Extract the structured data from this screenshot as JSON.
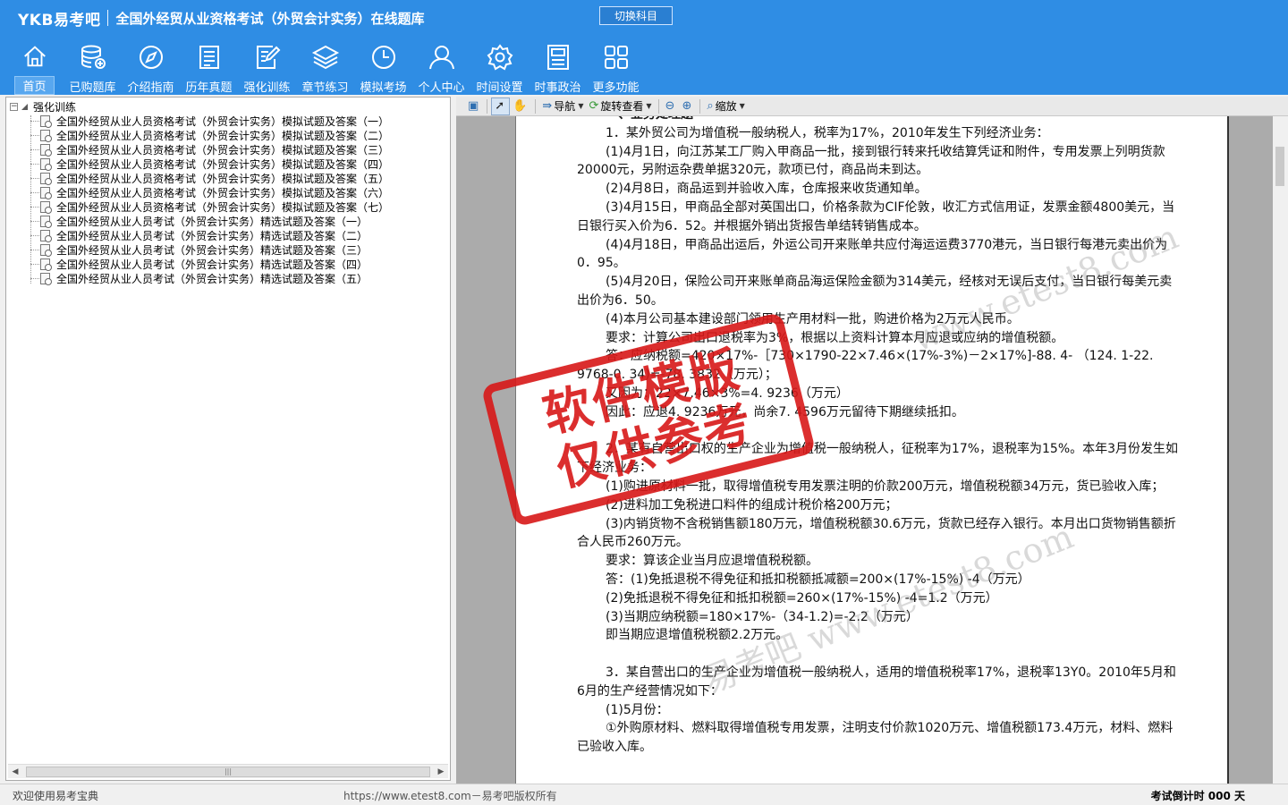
{
  "header": {
    "logo": "YKB易考吧",
    "title": "全国外经贸从业资格考试（外贸会计实务）在线题库",
    "switch_label": "切换科目"
  },
  "nav": [
    {
      "label": "首页",
      "icon": "home-icon"
    },
    {
      "label": "已购题库",
      "icon": "database-icon"
    },
    {
      "label": "介绍指南",
      "icon": "compass-icon"
    },
    {
      "label": "历年真题",
      "icon": "list-icon"
    },
    {
      "label": "强化训练",
      "icon": "edit-icon"
    },
    {
      "label": "章节练习",
      "icon": "layers-icon"
    },
    {
      "label": "模拟考场",
      "icon": "clock-icon"
    },
    {
      "label": "个人中心",
      "icon": "user-icon"
    },
    {
      "label": "时间设置",
      "icon": "gear-icon"
    },
    {
      "label": "时事政治",
      "icon": "news-icon"
    },
    {
      "label": "更多功能",
      "icon": "grid-icon"
    }
  ],
  "tree": {
    "expander": "−",
    "root": "强化训练",
    "items": [
      "全国外经贸从业人员资格考试（外贸会计实务）模拟试题及答案（一）",
      "全国外经贸从业人员资格考试（外贸会计实务）模拟试题及答案（二）",
      "全国外经贸从业人员资格考试（外贸会计实务）模拟试题及答案（三）",
      "全国外经贸从业人员资格考试（外贸会计实务）模拟试题及答案（四）",
      "全国外经贸从业人员资格考试（外贸会计实务）模拟试题及答案（五）",
      "全国外经贸从业人员资格考试（外贸会计实务）模拟试题及答案（六）",
      "全国外经贸从业人员资格考试（外贸会计实务）模拟试题及答案（七）",
      "全国外经贸从业人员考试（外贸会计实务）精选试题及答案（一）",
      "全国外经贸从业人员考试（外贸会计实务）精选试题及答案（二）",
      "全国外经贸从业人员考试（外贸会计实务）精选试题及答案（三）",
      "全国外经贸从业人员考试（外贸会计实务）精选试题及答案（四）",
      "全国外经贸从业人员考试（外贸会计实务）精选试题及答案（五）"
    ]
  },
  "toolbar": {
    "nav_label": "导航",
    "rotate_label": "旋转查看",
    "zoom_label": "缩放"
  },
  "document": {
    "heading": "一、业务处理题",
    "lines": [
      {
        "t": "1．某外贸公司为增值税一般纳税人，税率为17%，2010年发生下列经济业务：",
        "i": true
      },
      {
        "t": "(1)4月1日，向江苏某工厂购入甲商品一批，接到银行转来托收结算凭证和附件，专用发票上列明货款20000元，另附运杂费单据320元，款项已付，商品尚未到达。",
        "i": true
      },
      {
        "t": "(2)4月8日，商品运到并验收入库，仓库报来收货通知单。",
        "i": true
      },
      {
        "t": "(3)4月15日，甲商品全部对英国出口，价格条款为CIF伦敦，收汇方式信用证，发票金额4800美元，当日银行买入价为6．52。并根据外销出货报告单结转销售成本。",
        "i": true
      },
      {
        "t": "(4)4月18日，甲商品出运后，外运公司开来账单共应付海运运费3770港元，当日银行每港元卖出价为0．95。",
        "i": true
      },
      {
        "t": "(5)4月20日，保险公司开来账单商品海运保险金额为314美元，经核对无误后支付，当日银行每美元卖出价为6．50。",
        "i": true
      },
      {
        "t": "(4)本月公司基本建设部门领用生产用材料一批，购进价格为2万元人民币。",
        "i": true
      },
      {
        "t": "要求：计算公司出口退税率为3%，根据以上资料计算本月应退或应纳的增值税额。",
        "i": true
      },
      {
        "t": "答：应纳税额=420×17%-［730×1790-22×7.46×(17%-3%)－2×17%]-88. 4- （124. 1-22. 9768-0. 34)=-78. 3832（万元）；",
        "i": true
      },
      {
        "t": "又因为：22×7.46×3%=4. 9236（万元）",
        "i": true
      },
      {
        "t": "因此：应退4. 9236万元，尚余7. 4596万元留待下期继续抵扣。",
        "i": true
      },
      {
        "t": "",
        "gap": true
      },
      {
        "t": "2．某有自营出口权的生产企业为增值税一般纳税人，征税率为17%，退税率为15%。本年3月份发生如下经济业务：",
        "i": true
      },
      {
        "t": "(1)购进原材料一批，取得增值税专用发票注明的价款200万元，增值税税额34万元，货已验收入库；",
        "i": true
      },
      {
        "t": "(2)进料加工免税进口料件的组成计税价格200万元；",
        "i": true
      },
      {
        "t": "(3)内销货物不含税销售额180万元，增值税税额30.6万元，货款已经存入银行。本月出口货物销售额折合人民币260万元。",
        "i": true
      },
      {
        "t": "要求：算该企业当月应退增值税税额。",
        "i": true
      },
      {
        "t": "答：(1)免抵退税不得免征和抵扣税额抵减额=200×(17%-15%) -4（万元）",
        "i": true
      },
      {
        "t": "(2)免抵退税不得免征和抵扣税额=260×(17%-15%) -4=1.2（万元）",
        "i": true
      },
      {
        "t": "(3)当期应纳税额=180×17%-（34-1.2)=-2.2（万元）",
        "i": true
      },
      {
        "t": "即当期应退增值税税额2.2万元。",
        "i": true
      },
      {
        "t": "",
        "gap": true
      },
      {
        "t": "3．某自营出口的生产企业为增值税一般纳税人，适用的增值税税率17%，退税率13Y0。2010年5月和6月的生产经营情况如下：",
        "i": true
      },
      {
        "t": "(1)5月份：",
        "i": true
      },
      {
        "t": "①外购原材料、燃料取得增值税专用发票，注明支付价款1020万元、增值税额173.4万元，材料、燃料已验收入库。",
        "i": true
      }
    ]
  },
  "watermark": {
    "stamp_line1": "软件模版",
    "stamp_line2": "仅供参考",
    "site1": "www.etest8.com",
    "site2": "易考吧 www.etest8.com"
  },
  "status": {
    "left": "欢迎使用易考宝典",
    "center": "https://www.etest8.com－易考吧版权所有",
    "right": "考试倒计时 000 天"
  },
  "colors": {
    "header_bg": "#2f8de4",
    "stamp_red": "#d81818"
  }
}
